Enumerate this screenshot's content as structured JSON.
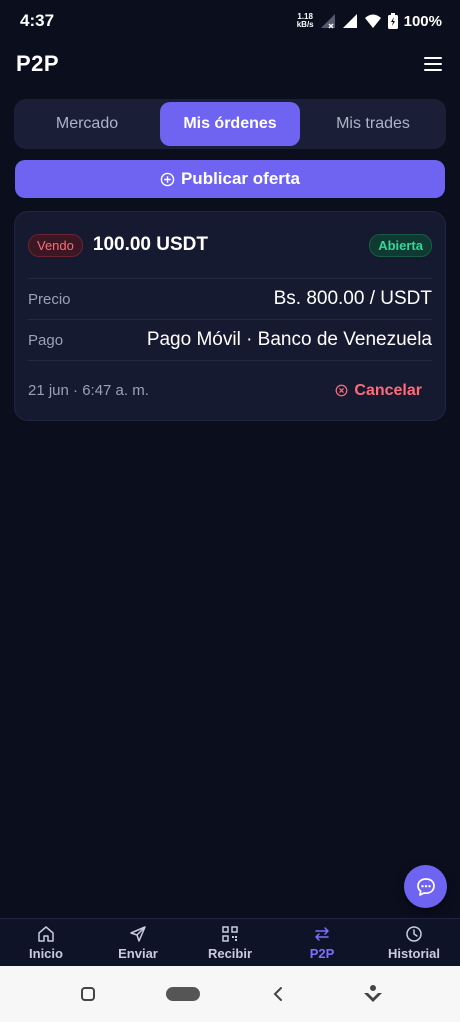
{
  "status_bar": {
    "time": "4:37",
    "net_speed_value": "1.18",
    "net_speed_unit": "kB/s",
    "battery": "100%"
  },
  "app_bar": {
    "title": "P2P",
    "menu_icon": "hamburger-menu-icon"
  },
  "tabs": [
    {
      "label": "Mercado",
      "active": false
    },
    {
      "label": "Mis órdenes",
      "active": true
    },
    {
      "label": "Mis trades",
      "active": false
    }
  ],
  "publish_button": {
    "label": "Publicar oferta",
    "icon": "plus-circle-icon"
  },
  "order": {
    "side": "Vendo",
    "amount": "100.00 USDT",
    "status": "Abierta",
    "price_label": "Precio",
    "price_value": "Bs. 800.00 / USDT",
    "payment_label": "Pago",
    "payment_value": "Pago Móvil · Banco de Venezuela",
    "date": "21 jun · 6:47 a. m.",
    "cancel_label": "Cancelar"
  },
  "fab": {
    "icon": "chat-bubble-icon"
  },
  "bottom_nav": [
    {
      "label": "Inicio",
      "icon": "home-icon",
      "active": false
    },
    {
      "label": "Enviar",
      "icon": "send-icon",
      "active": false
    },
    {
      "label": "Recibir",
      "icon": "qr-code-icon",
      "active": false
    },
    {
      "label": "P2P",
      "icon": "swap-arrows-icon",
      "active": true
    },
    {
      "label": "Historial",
      "icon": "clock-icon",
      "active": false
    }
  ],
  "colors": {
    "background": "#0b0e1d",
    "accent": "#6f63f1",
    "card": "#151a30",
    "danger": "#ff6b78",
    "success": "#35d69a"
  }
}
